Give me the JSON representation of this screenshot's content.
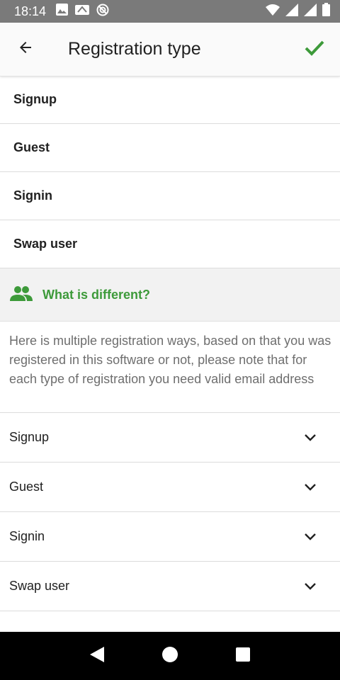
{
  "status_bar": {
    "time": "18:14",
    "left_icons": [
      "image-icon",
      "wallet-icon",
      "do-not-disturb-icon"
    ],
    "right_icons": [
      "wifi-icon",
      "signal-icon",
      "signal-icon",
      "battery-icon"
    ]
  },
  "app_bar": {
    "title": "Registration type",
    "back_icon": "arrow-left-icon",
    "confirm_icon": "check-icon",
    "accent": "#3d9a3a"
  },
  "options": [
    {
      "label": "Signup"
    },
    {
      "label": "Guest"
    },
    {
      "label": "Signin"
    },
    {
      "label": "Swap user"
    }
  ],
  "info": {
    "header_icon": "people-icon",
    "header_label": "What is different?",
    "description": "Here is multiple registration ways, based on that you was registered in this software or not, please note that for each type of registration you need valid email address"
  },
  "accordion": [
    {
      "label": "Signup",
      "expanded": false
    },
    {
      "label": "Guest",
      "expanded": false
    },
    {
      "label": "Signin",
      "expanded": false
    },
    {
      "label": "Swap user",
      "expanded": false
    }
  ],
  "nav_bar": {
    "buttons": [
      "back-triangle-icon",
      "home-circle-icon",
      "recents-square-icon"
    ]
  }
}
